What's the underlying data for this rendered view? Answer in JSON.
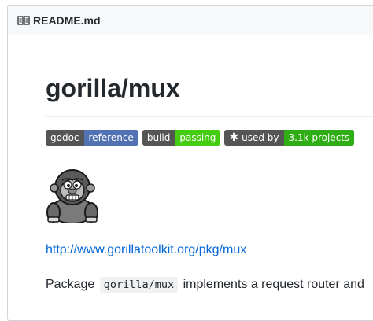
{
  "readme": {
    "filename": "README.md",
    "icon": "book-icon"
  },
  "content": {
    "title": "gorilla/mux",
    "badges": [
      {
        "label": "godoc",
        "value": "reference",
        "color": "#5272b4"
      },
      {
        "label": "build",
        "value": "passing",
        "color": "#44cc11"
      },
      {
        "label": "used by",
        "value": "3.1k projects",
        "color": "#2fad14",
        "icon": "asterisk-icon"
      }
    ],
    "logo": "gorilla-logo",
    "link": "http://www.gorillatoolkit.org/pkg/mux",
    "paragraph": {
      "before": "Package",
      "code": "gorilla/mux",
      "after": "implements a request router and"
    }
  },
  "colors": {
    "link": "#0366d6",
    "text": "#24292e",
    "header_bg": "#f6f8fa"
  }
}
